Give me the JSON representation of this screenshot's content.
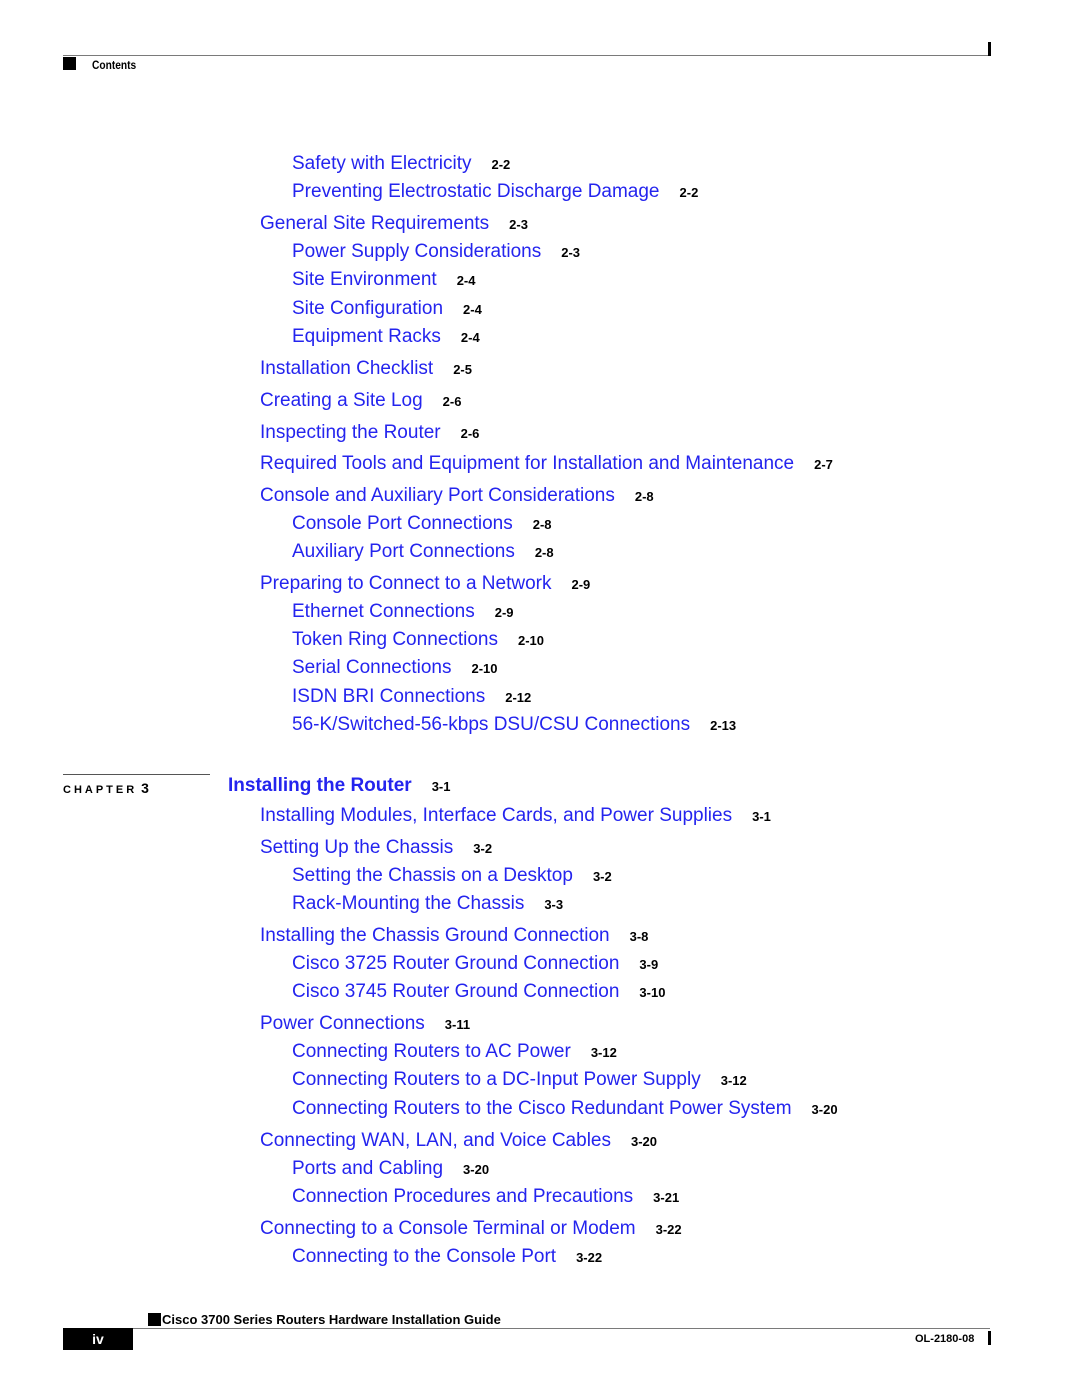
{
  "header": {
    "title": "Contents"
  },
  "colors": {
    "link": "#2424ee",
    "text": "#000000"
  },
  "toc_before": [
    {
      "level": 2,
      "title": "Safety with Electricity",
      "page": "2-2"
    },
    {
      "level": 2,
      "title": "Preventing Electrostatic Discharge Damage",
      "page": "2-2"
    },
    {
      "level": 1,
      "title": "General Site Requirements",
      "page": "2-3"
    },
    {
      "level": 2,
      "title": "Power Supply Considerations",
      "page": "2-3"
    },
    {
      "level": 2,
      "title": "Site Environment",
      "page": "2-4"
    },
    {
      "level": 2,
      "title": "Site Configuration",
      "page": "2-4"
    },
    {
      "level": 2,
      "title": "Equipment Racks",
      "page": "2-4"
    },
    {
      "level": 1,
      "title": "Installation Checklist",
      "page": "2-5"
    },
    {
      "level": 1,
      "title": "Creating a Site Log",
      "page": "2-6"
    },
    {
      "level": 1,
      "title": "Inspecting the Router",
      "page": "2-6"
    },
    {
      "level": 1,
      "title": "Required Tools and Equipment for Installation and Maintenance",
      "page": "2-7"
    },
    {
      "level": 1,
      "title": "Console and Auxiliary Port Considerations",
      "page": "2-8"
    },
    {
      "level": 2,
      "title": "Console Port Connections",
      "page": "2-8"
    },
    {
      "level": 2,
      "title": "Auxiliary Port Connections",
      "page": "2-8"
    },
    {
      "level": 1,
      "title": "Preparing to Connect to a Network",
      "page": "2-9"
    },
    {
      "level": 2,
      "title": "Ethernet Connections",
      "page": "2-9"
    },
    {
      "level": 2,
      "title": "Token Ring Connections",
      "page": "2-10"
    },
    {
      "level": 2,
      "title": "Serial Connections",
      "page": "2-10"
    },
    {
      "level": 2,
      "title": "ISDN BRI Connections",
      "page": "2-12"
    },
    {
      "level": 2,
      "title": "56-K/Switched-56-kbps DSU/CSU Connections",
      "page": "2-13"
    }
  ],
  "chapter": {
    "label": "CHAPTER",
    "number": "3",
    "title": "Installing the Router",
    "page": "3-1"
  },
  "toc_after": [
    {
      "level": 1,
      "title": "Installing Modules, Interface Cards, and Power Supplies",
      "page": "3-1"
    },
    {
      "level": 1,
      "title": "Setting Up the Chassis",
      "page": "3-2"
    },
    {
      "level": 2,
      "title": "Setting the Chassis on a Desktop",
      "page": "3-2"
    },
    {
      "level": 2,
      "title": "Rack-Mounting the Chassis",
      "page": "3-3"
    },
    {
      "level": 1,
      "title": "Installing the Chassis Ground Connection",
      "page": "3-8"
    },
    {
      "level": 2,
      "title": "Cisco 3725 Router Ground Connection",
      "page": "3-9"
    },
    {
      "level": 2,
      "title": "Cisco 3745 Router Ground Connection",
      "page": "3-10"
    },
    {
      "level": 1,
      "title": "Power Connections",
      "page": "3-11"
    },
    {
      "level": 2,
      "title": "Connecting Routers to AC Power",
      "page": "3-12"
    },
    {
      "level": 2,
      "title": "Connecting Routers to a DC-Input Power Supply",
      "page": "3-12"
    },
    {
      "level": 2,
      "title": "Connecting Routers to the Cisco Redundant Power System",
      "page": "3-20"
    },
    {
      "level": 1,
      "title": "Connecting WAN, LAN, and Voice Cables",
      "page": "3-20"
    },
    {
      "level": 2,
      "title": "Ports and Cabling",
      "page": "3-20"
    },
    {
      "level": 2,
      "title": "Connection Procedures and Precautions",
      "page": "3-21"
    },
    {
      "level": 1,
      "title": "Connecting to a Console Terminal or Modem",
      "page": "3-22"
    },
    {
      "level": 2,
      "title": "Connecting to the Console Port",
      "page": "3-22"
    }
  ],
  "footer": {
    "guide_title": "Cisco 3700 Series Routers Hardware Installation Guide",
    "page_number": "iv",
    "doc_number": "OL-2180-08"
  }
}
